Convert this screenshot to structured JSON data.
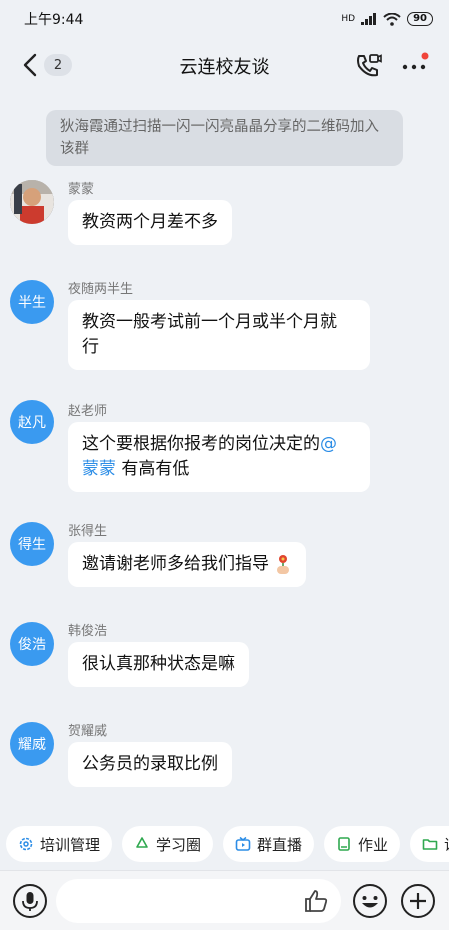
{
  "status": {
    "time": "上午9:44",
    "battery": "90",
    "network": "HD"
  },
  "header": {
    "title": "云连校友谈",
    "unread_count": "2"
  },
  "system_notice": "狄海霞通过扫描一闪一闪亮晶晶分享的二维码加入该群",
  "messages": [
    {
      "sender": "蒙蒙",
      "avatar_text": "",
      "avatar_type": "photo",
      "text": "教资两个月差不多"
    },
    {
      "sender": "夜随两半生",
      "avatar_text": "半生",
      "avatar_type": "text",
      "text_line1": "教资一般考试前一个月或半个月就",
      "text_line2": "行"
    },
    {
      "sender": "赵老师",
      "avatar_text": "赵凡",
      "avatar_type": "text",
      "text_line1": "这个要根据你报考的岗位决定的",
      "mention": "@",
      "mention_name": "蒙蒙",
      "text_after": " 有高有低"
    },
    {
      "sender": "张得生",
      "avatar_text": "得生",
      "avatar_type": "text",
      "text": "邀请谢老师多给我们指导"
    },
    {
      "sender": "韩俊浩",
      "avatar_text": "俊浩",
      "avatar_type": "text",
      "text": "很认真那种状态是嘛"
    },
    {
      "sender": "贺耀威",
      "avatar_text": "耀威",
      "avatar_type": "text",
      "text": "公务员的录取比例"
    }
  ],
  "quick_actions": [
    {
      "label": "培训管理",
      "icon": "gear-icon"
    },
    {
      "label": "学习圈",
      "icon": "recycle-icon"
    },
    {
      "label": "群直播",
      "icon": "tv-icon"
    },
    {
      "label": "作业",
      "icon": "book-icon"
    },
    {
      "label": "课件",
      "icon": "folder-icon"
    }
  ],
  "colors": {
    "accent": "#3a9af0",
    "mention": "#2c8de6",
    "background": "#eef1f5"
  }
}
